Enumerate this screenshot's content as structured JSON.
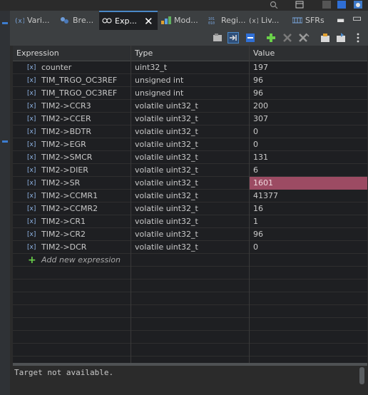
{
  "tabs": [
    {
      "label": "Vari...",
      "icon": "variables-icon",
      "active": false
    },
    {
      "label": "Bre...",
      "icon": "breakpoints-icon",
      "active": false
    },
    {
      "label": "Exp...",
      "icon": "expressions-icon",
      "active": true
    },
    {
      "label": "Mod...",
      "icon": "modules-icon",
      "active": false
    },
    {
      "label": "Regi...",
      "icon": "registers-icon",
      "active": false
    },
    {
      "label": "Liv...",
      "icon": "live-expressions-icon",
      "active": false
    },
    {
      "label": "SFRs",
      "icon": "sfrs-icon",
      "active": false
    }
  ],
  "columns": {
    "expression": "Expression",
    "type": "Type",
    "value": "Value"
  },
  "rows": [
    {
      "expression": "counter",
      "type": "uint32_t",
      "value": "197"
    },
    {
      "expression": "TIM_TRGO_OC3REF",
      "type": "unsigned int",
      "value": "96"
    },
    {
      "expression": "TIM_TRGO_OC3REF",
      "type": "unsigned int",
      "value": "96"
    },
    {
      "expression": "TIM2->CCR3",
      "type": "volatile uint32_t",
      "value": "200"
    },
    {
      "expression": "TIM2->CCER",
      "type": "volatile uint32_t",
      "value": "307"
    },
    {
      "expression": "TIM2->BDTR",
      "type": "volatile uint32_t",
      "value": "0"
    },
    {
      "expression": "TIM2->EGR",
      "type": "volatile uint32_t",
      "value": "0"
    },
    {
      "expression": "TIM2->SMCR",
      "type": "volatile uint32_t",
      "value": "131"
    },
    {
      "expression": "TIM2->DIER",
      "type": "volatile uint32_t",
      "value": "6"
    },
    {
      "expression": "TIM2->SR",
      "type": "volatile uint32_t",
      "value": "1601",
      "changed": true
    },
    {
      "expression": "TIM2->CCMR1",
      "type": "volatile uint32_t",
      "value": "41377"
    },
    {
      "expression": "TIM2->CCMR2",
      "type": "volatile uint32_t",
      "value": "16"
    },
    {
      "expression": "TIM2->CR1",
      "type": "volatile uint32_t",
      "value": "1"
    },
    {
      "expression": "TIM2->CR2",
      "type": "volatile uint32_t",
      "value": "96"
    },
    {
      "expression": "TIM2->DCR",
      "type": "volatile uint32_t",
      "value": "0"
    }
  ],
  "add_expression": "Add new expression",
  "console_text": "Target not available.",
  "colors": {
    "changed_value_bg": "#9c4b63",
    "accent": "#4a88c7",
    "add_icon": "#6ad04a"
  }
}
